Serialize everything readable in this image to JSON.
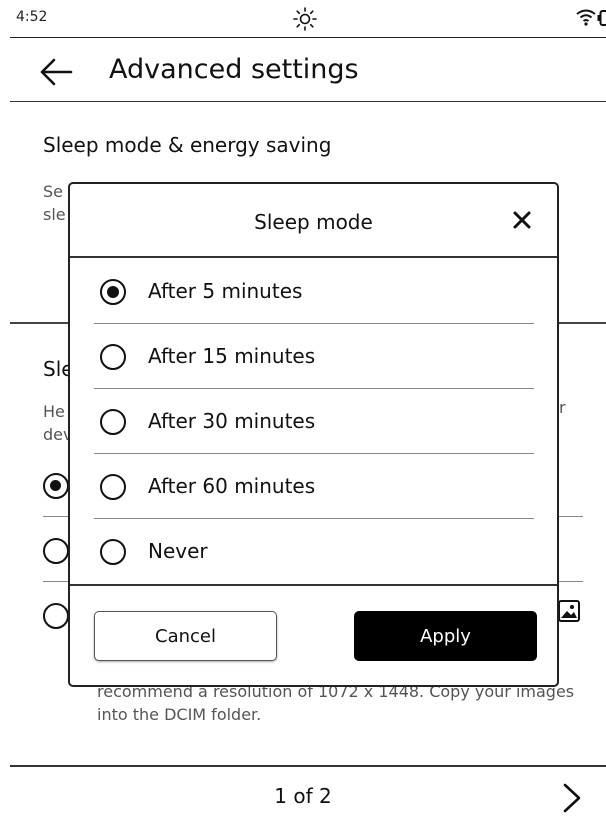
{
  "status_bar": {
    "time": "4:52",
    "icons": [
      "brightness-icon",
      "wifi-icon",
      "battery-icon"
    ]
  },
  "header": {
    "title": "Advanced settings",
    "back_icon": "arrow-left-icon"
  },
  "sections": [
    {
      "title": "Sleep mode & energy saving",
      "description_fragments": [
        "Se",
        "sle"
      ]
    },
    {
      "title_fragment": "Sle",
      "description_fragments": [
        "He",
        "dev",
        "r"
      ],
      "radio_checked_index": 0,
      "trailing_text": "recommend a resolution of 1072 x 1448. Copy your images into the DCIM folder."
    }
  ],
  "dialog": {
    "title": "Sleep mode",
    "close_icon": "close-icon",
    "options": [
      {
        "label": "After 5 minutes",
        "selected": true
      },
      {
        "label": "After 15 minutes",
        "selected": false
      },
      {
        "label": "After 30 minutes",
        "selected": false
      },
      {
        "label": "After 60 minutes",
        "selected": false
      },
      {
        "label": "Never",
        "selected": false
      }
    ],
    "cancel_label": "Cancel",
    "apply_label": "Apply"
  },
  "footer": {
    "page_indicator": "1 of 2",
    "next_icon": "chevron-right-icon"
  }
}
